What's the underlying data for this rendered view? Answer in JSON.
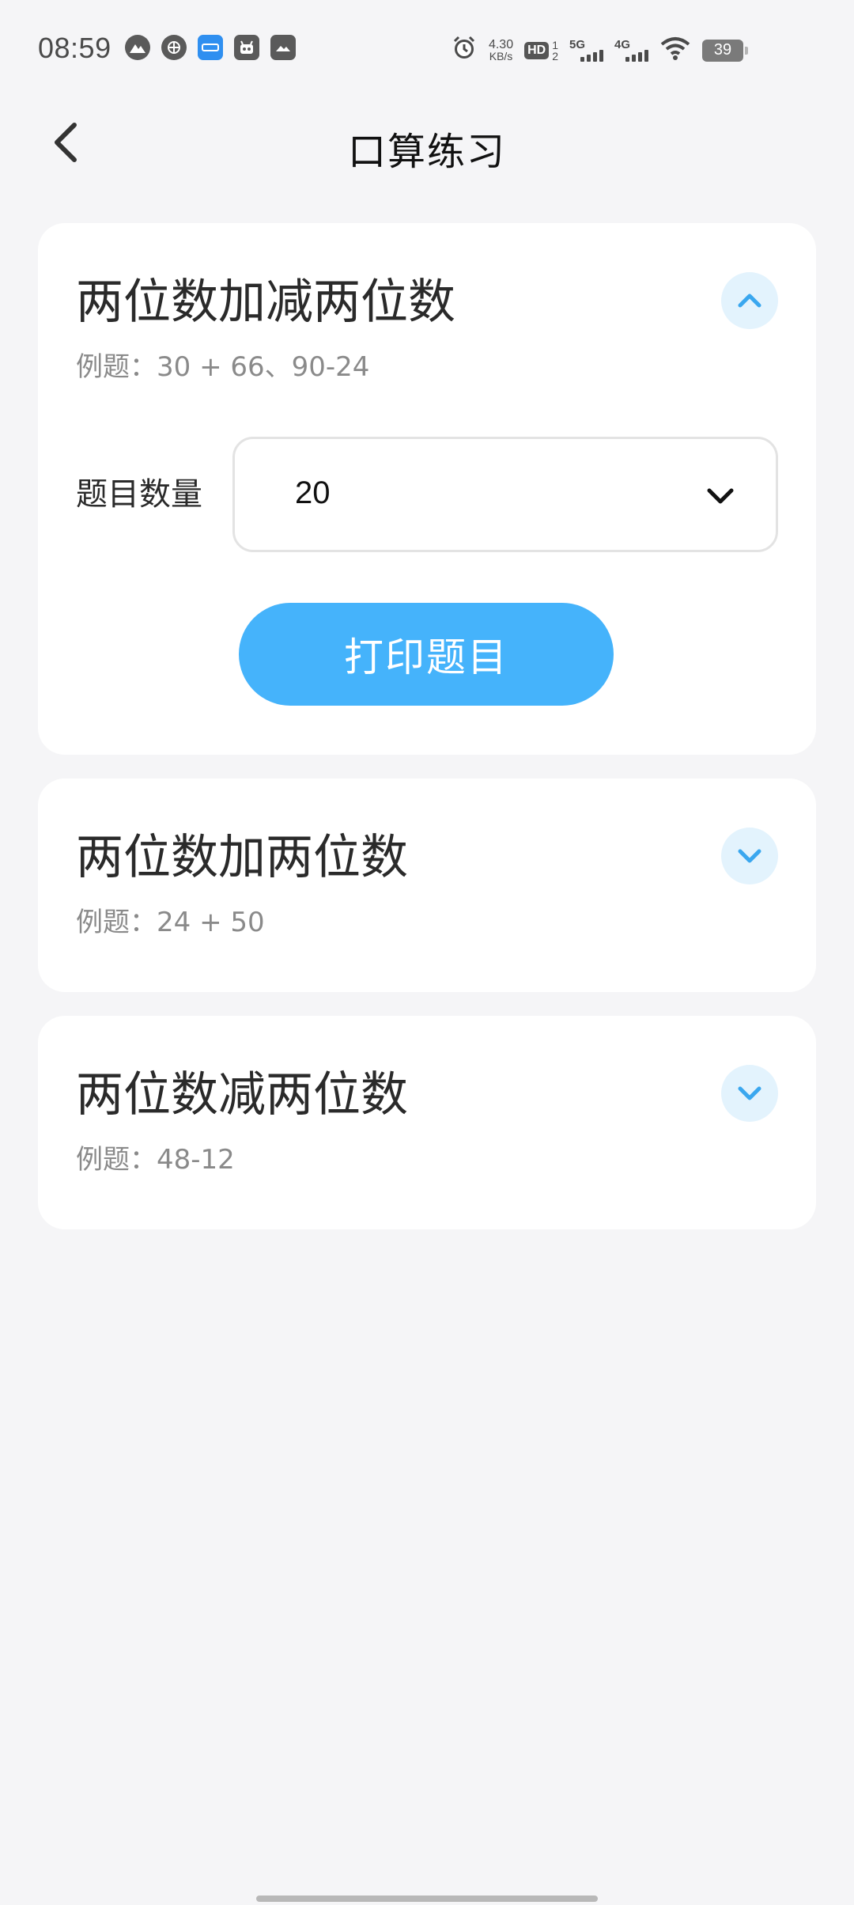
{
  "status_bar": {
    "time": "08:59",
    "net_speed_value": "4.30",
    "net_speed_unit": "KB/s",
    "hd_label": "HD",
    "sim1_label": "1",
    "sim2_label": "2",
    "signal1_label": "5G",
    "signal2_label": "4G",
    "battery_level": "39",
    "left_icons": [
      "mountain-app-icon",
      "cellular-app-icon",
      "blue-app-icon",
      "robot-app-icon",
      "image-app-icon"
    ],
    "right_icons": [
      "alarm-icon",
      "wifi-icon",
      "battery-icon"
    ]
  },
  "header": {
    "title": "口算练习",
    "back_icon": "chevron-left-icon"
  },
  "cards": [
    {
      "title": "两位数加减两位数",
      "example": "例题：30 + 66、90-24",
      "expanded": true,
      "toggle_icon": "chevron-up-icon",
      "count_label": "题目数量",
      "count_value": "20",
      "select_icon": "chevron-down-icon",
      "print_label": "打印题目"
    },
    {
      "title": "两位数加两位数",
      "example": "例题：24 + 50",
      "expanded": false,
      "toggle_icon": "chevron-down-icon"
    },
    {
      "title": "两位数减两位数",
      "example": "例题：48-12",
      "expanded": false,
      "toggle_icon": "chevron-down-icon"
    }
  ],
  "colors": {
    "background": "#f5f5f7",
    "card": "#ffffff",
    "accent": "#45b3fb",
    "toggle_bg": "#e3f3fd",
    "toggle_icon": "#3aa7ef",
    "muted_text": "#8a8a8a"
  }
}
